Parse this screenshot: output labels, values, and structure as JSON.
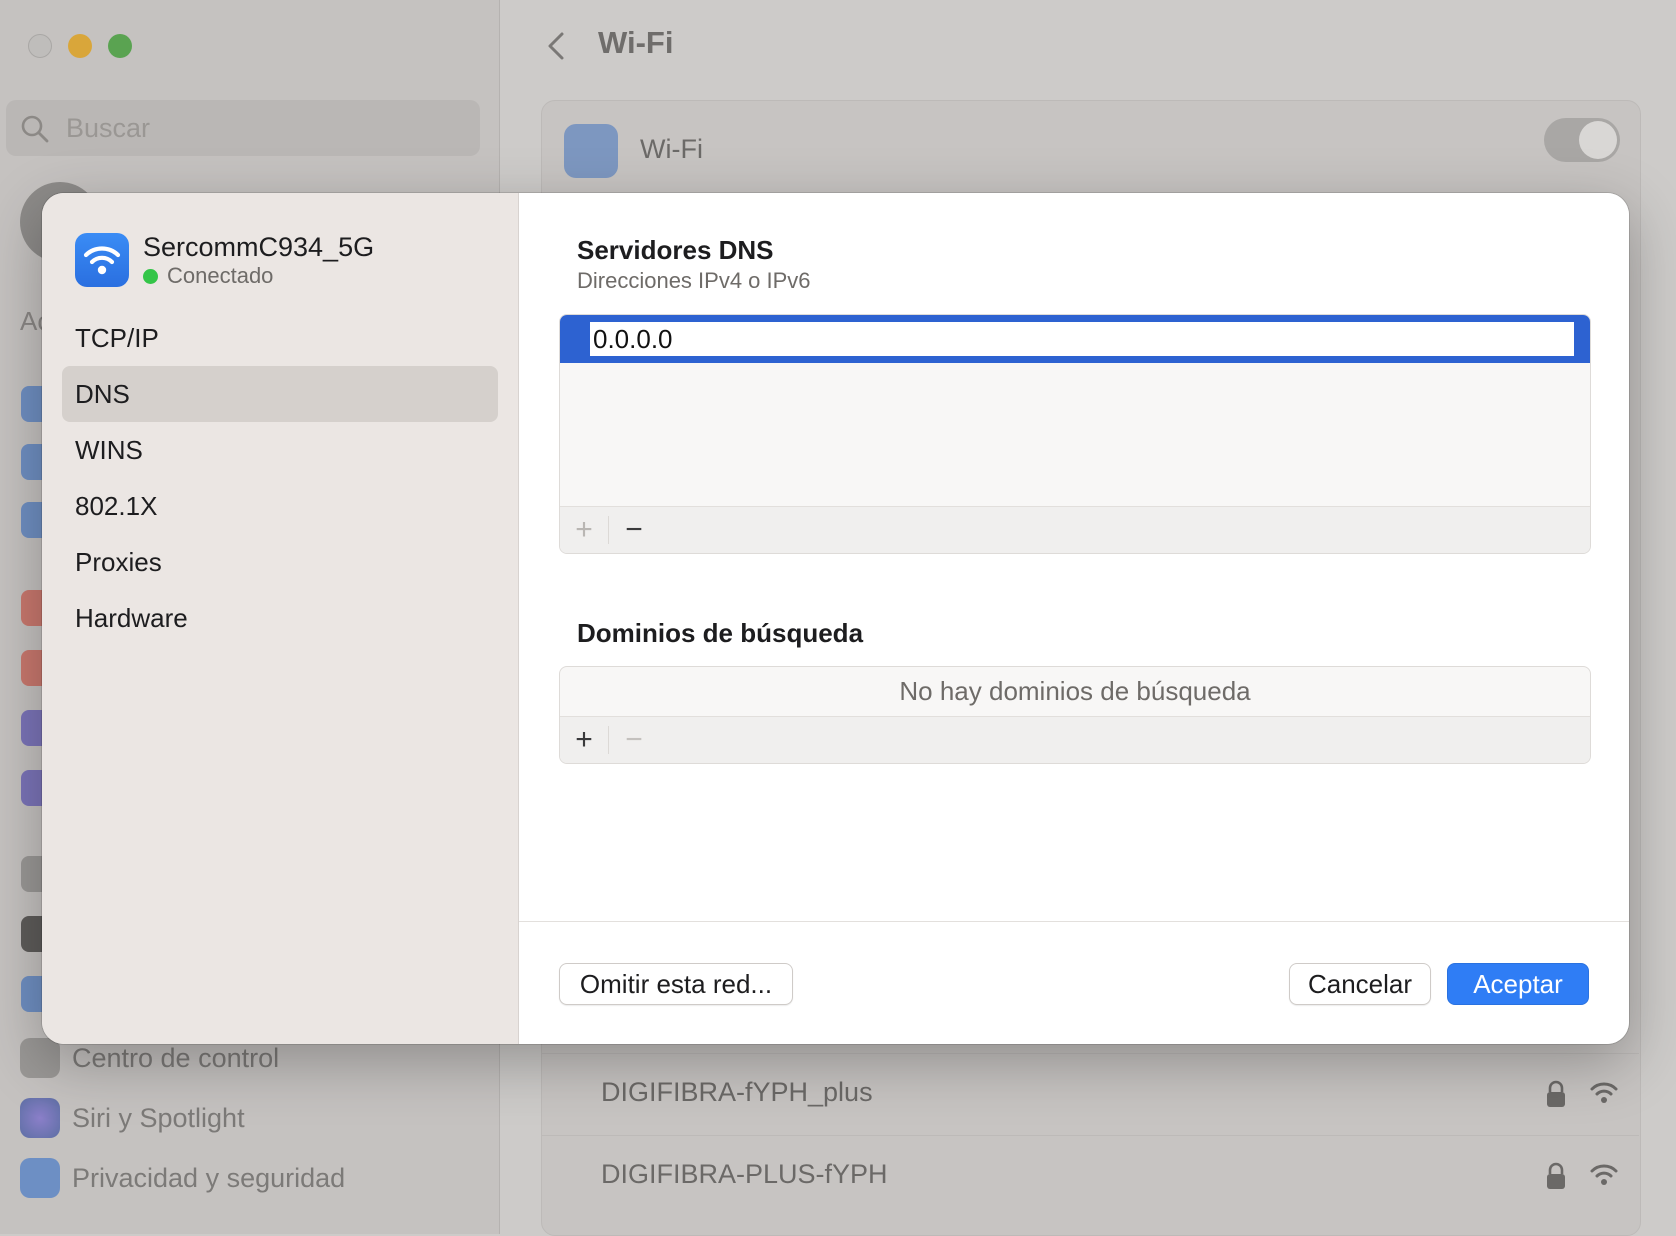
{
  "background": {
    "search_placeholder": "Buscar",
    "sidebar_partial_label": "Ac",
    "sidebar_items": [
      {
        "label": "Centro de control",
        "color": "#9a9896"
      },
      {
        "label": "Siri y Spotlight",
        "color": "#8d6fa8"
      },
      {
        "label": "Privacidad y seguridad",
        "color": "#6d8fc4"
      }
    ],
    "page_title": "Wi-Fi",
    "wifi_label": "Wi-Fi",
    "networks": [
      {
        "name": "DIGIFIBRA-fYPH_plus"
      },
      {
        "name": "DIGIFIBRA-PLUS-fYPH"
      }
    ]
  },
  "sheet": {
    "network_name": "SercommC934_5G",
    "network_status": "Conectado",
    "nav": [
      {
        "label": "TCP/IP",
        "active": false
      },
      {
        "label": "DNS",
        "active": true
      },
      {
        "label": "WINS",
        "active": false
      },
      {
        "label": "802.1X",
        "active": false
      },
      {
        "label": "Proxies",
        "active": false
      },
      {
        "label": "Hardware",
        "active": false
      }
    ],
    "dns_title": "Servidores DNS",
    "dns_subtitle": "Direcciones IPv4 o IPv6",
    "dns_servers": [
      "0.0.0.0"
    ],
    "domains_title": "Dominios de búsqueda",
    "domains_empty": "No hay dominios de búsqueda",
    "plus": "+",
    "minus": "−",
    "forget_button": "Omitir esta red...",
    "cancel_button": "Cancelar",
    "ok_button": "Aceptar"
  },
  "colors": {
    "accent": "#2f7df5",
    "selection": "#2d62d1",
    "status_connected": "#34c548"
  }
}
